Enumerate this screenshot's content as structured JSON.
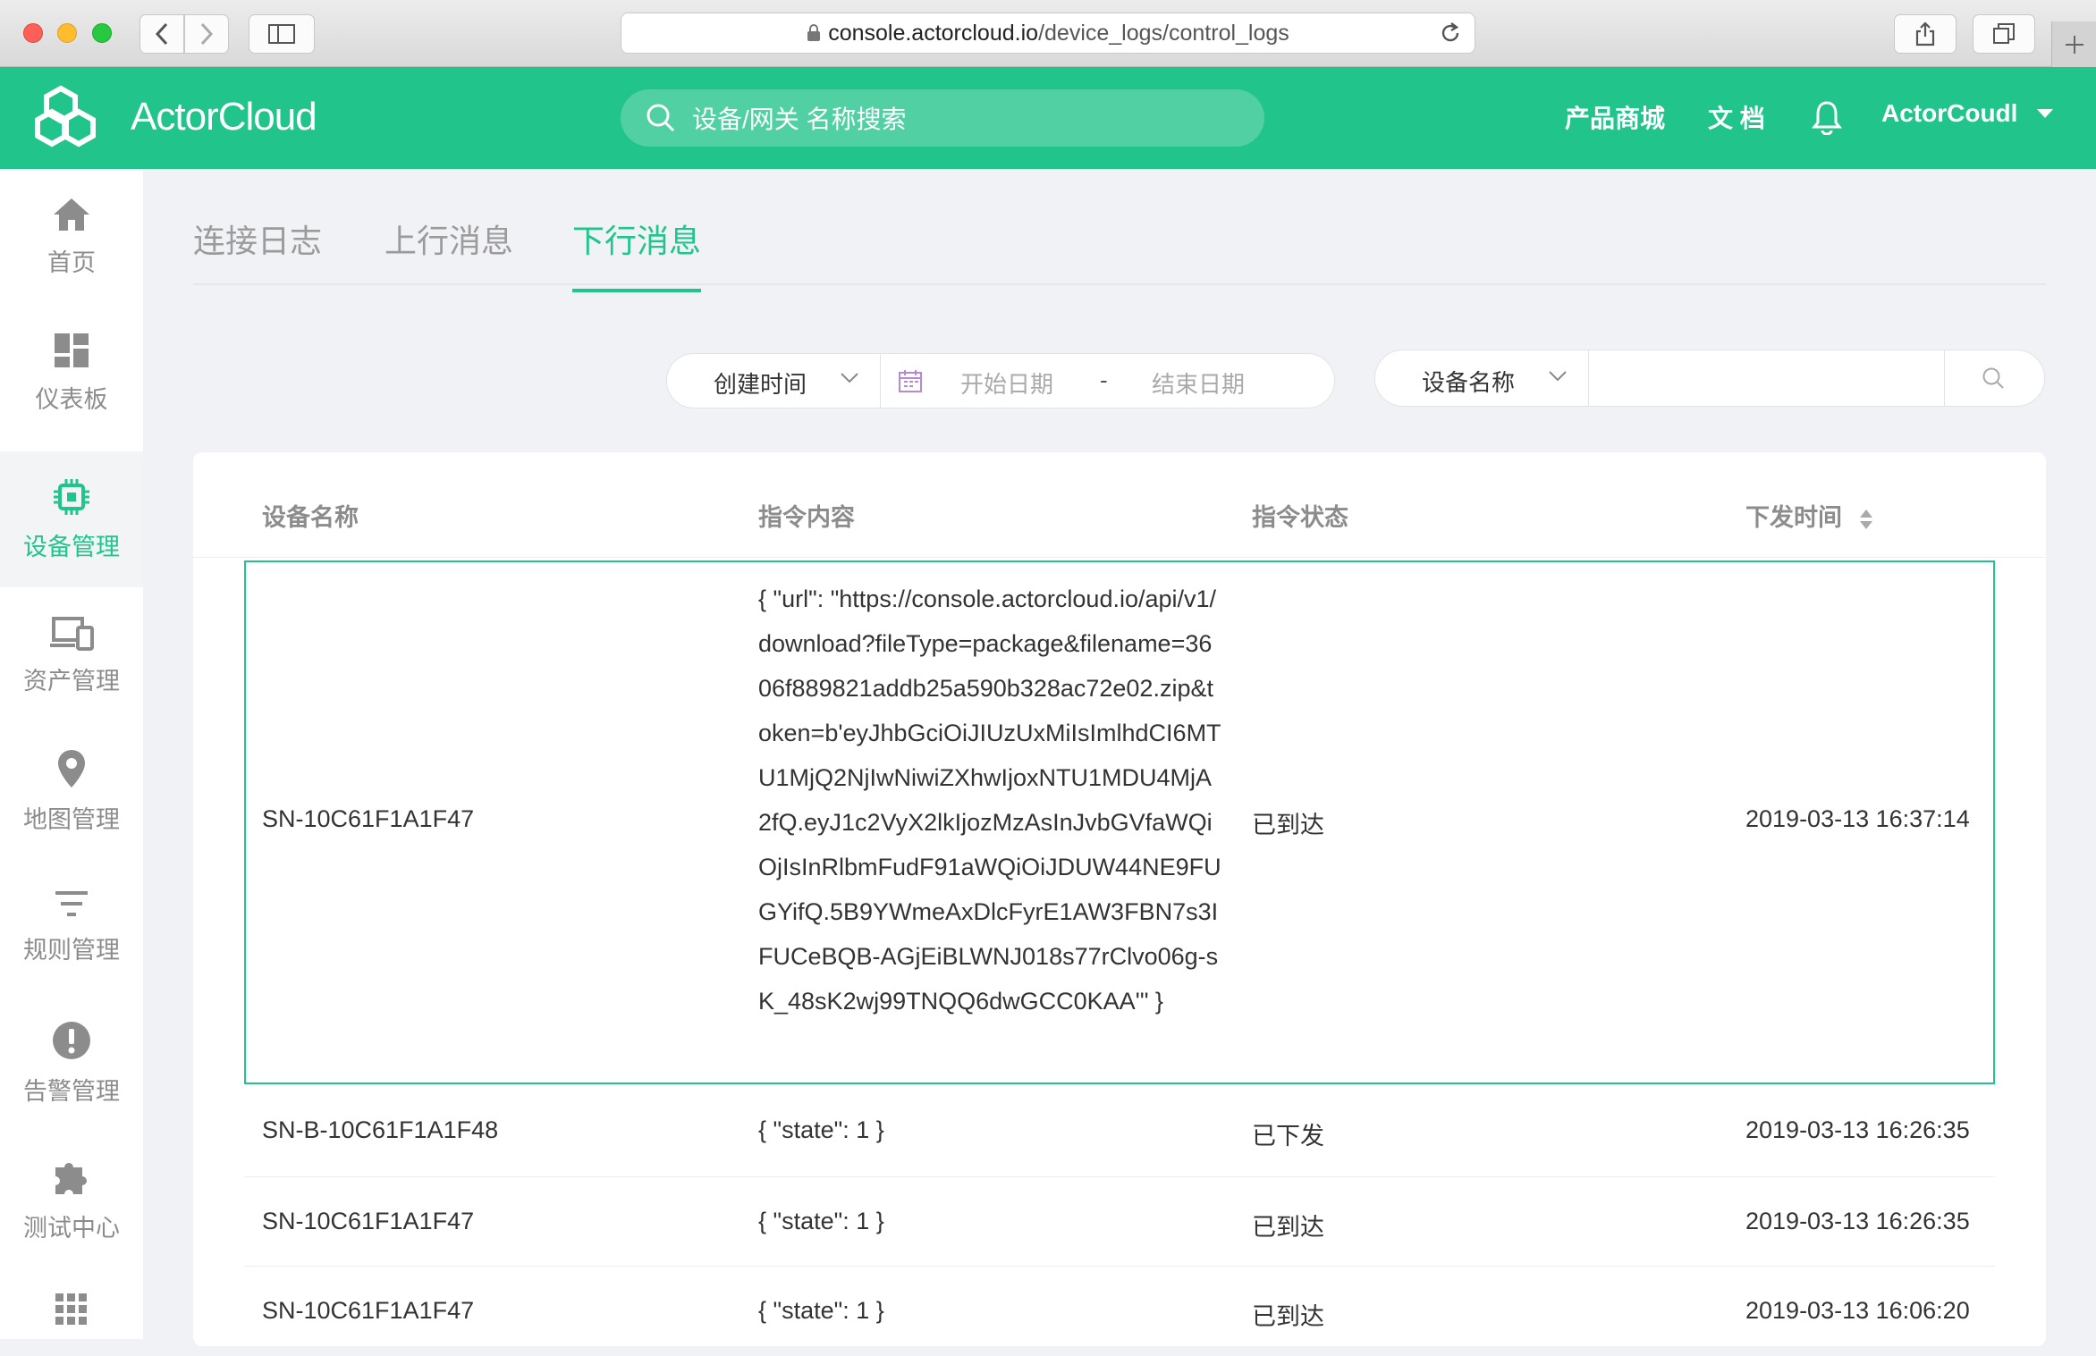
{
  "browser": {
    "url_host": "console.actorcloud.io",
    "url_path": "/device_logs/control_logs"
  },
  "header": {
    "logo_text": "ActorCloud",
    "search_placeholder": "设备/网关 名称搜索",
    "link_store": "产品商城",
    "link_docs": "文 档",
    "user_name": "ActorCoudl"
  },
  "sidebar": {
    "items": [
      {
        "label": "首页",
        "icon": "home-icon"
      },
      {
        "label": "仪表板",
        "icon": "dashboard-icon"
      },
      {
        "label": "设备管理",
        "icon": "chip-icon"
      },
      {
        "label": "资产管理",
        "icon": "devices-icon"
      },
      {
        "label": "地图管理",
        "icon": "map-pin-icon"
      },
      {
        "label": "规则管理",
        "icon": "filter-icon"
      },
      {
        "label": "告警管理",
        "icon": "alert-icon"
      },
      {
        "label": "测试中心",
        "icon": "puzzle-icon"
      },
      {
        "label": "",
        "icon": "grid-icon"
      }
    ],
    "active_index": 2
  },
  "tabs": [
    "连接日志",
    "上行消息",
    "下行消息"
  ],
  "active_tab": 2,
  "filters": {
    "date_field": "创建时间",
    "start_placeholder": "开始日期",
    "separator": "-",
    "end_placeholder": "结束日期",
    "name_field": "设备名称",
    "name_value": ""
  },
  "table": {
    "columns": [
      "设备名称",
      "指令内容",
      "指令状态",
      "下发时间"
    ],
    "rows": [
      {
        "device": "SN-10C61F1A1F47",
        "command": "{ \"url\": \"https://console.actorcloud.io/api/v1/download?fileType=package&filename=3606f889821addb25a590b328ac72e02.zip&token=b'eyJhbGciOiJIUzUxMiIsImlhdCI6MTU1MjQ2NjIwNiwiZXhwIjoxNTU1MDU4MjA2fQ.eyJ1c2VyX2lkIjozMzAsInJvbGVfaWQiOjIsInRlbmFudF91aWQiOiJDUW44NE9FUGYifQ.5B9YWmeAxDlcFyrE1AW3FBN7s3IFUCeBQB-AGjEiBLWNJ018s77rClvo06g-sK_48sK2wj99TNQQ6dwGCC0KAA'\" }",
        "status": "已到达",
        "time": "2019-03-13 16:37:14"
      },
      {
        "device": "SN-B-10C61F1A1F48",
        "command": "{ \"state\": 1 }",
        "status": "已下发",
        "time": "2019-03-13 16:26:35"
      },
      {
        "device": "SN-10C61F1A1F47",
        "command": "{ \"state\": 1 }",
        "status": "已到达",
        "time": "2019-03-13 16:26:35"
      },
      {
        "device": "SN-10C61F1A1F47",
        "command": "{ \"state\": 1 }",
        "status": "已到达",
        "time": "2019-03-13 16:06:20"
      }
    ]
  },
  "colors": {
    "brand": "#21c48a",
    "text": "#333333",
    "muted": "#8c8c8c"
  }
}
